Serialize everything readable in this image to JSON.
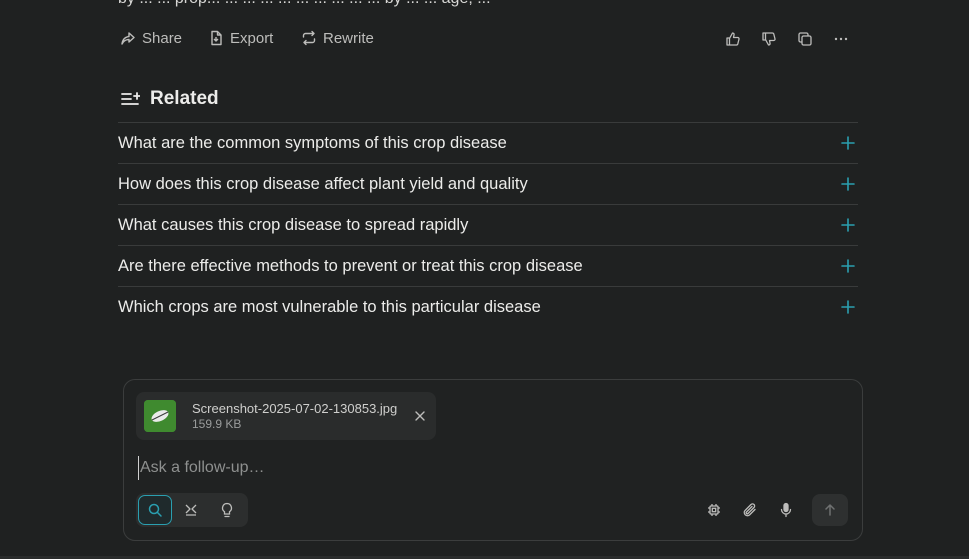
{
  "answer_fragment": "by ... ... prop... ... ... ... ... ... ... ... ... ... by ... ... age, ...",
  "actions": {
    "share_label": "Share",
    "export_label": "Export",
    "rewrite_label": "Rewrite"
  },
  "related": {
    "title": "Related",
    "items": [
      {
        "label": "What are the common symptoms of this crop disease"
      },
      {
        "label": "How does this crop disease affect plant yield and quality"
      },
      {
        "label": "What causes this crop disease to spread rapidly"
      },
      {
        "label": "Are there effective methods to prevent or treat this crop disease"
      },
      {
        "label": "Which crops are most vulnerable to this particular disease"
      }
    ]
  },
  "composer": {
    "attachment": {
      "file_name": "Screenshot-2025-07-02-130853.jpg",
      "file_size": "159.9 KB"
    },
    "placeholder": "Ask a follow-up…",
    "value": ""
  },
  "colors": {
    "background": "#1f2121",
    "accent": "#2a9fb0",
    "text": "#ececea",
    "muted": "#bdbdbb"
  }
}
